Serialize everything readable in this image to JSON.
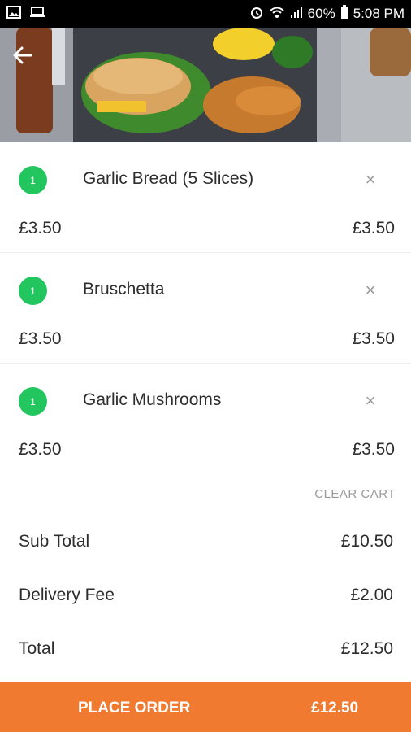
{
  "status_bar": {
    "battery": "60%",
    "time": "5:08 PM"
  },
  "header": {
    "back_icon": "arrow-left-icon"
  },
  "cart": {
    "items": [
      {
        "qty": "1",
        "name": "Garlic Bread (5 Slices)",
        "unit_price": "£3.50",
        "line_total": "£3.50"
      },
      {
        "qty": "1",
        "name": "Bruschetta",
        "unit_price": "£3.50",
        "line_total": "£3.50"
      },
      {
        "qty": "1",
        "name": "Garlic Mushrooms",
        "unit_price": "£3.50",
        "line_total": "£3.50"
      }
    ],
    "remove_symbol": "×",
    "clear_label": "CLEAR CART"
  },
  "summary": {
    "subtotal_label": "Sub Total",
    "subtotal_value": "£10.50",
    "delivery_label": "Delivery Fee",
    "delivery_value": "£2.00",
    "total_label": "Total",
    "total_value": "£12.50"
  },
  "footer": {
    "place_order_label": "PLACE ORDER",
    "place_order_amount": "£12.50"
  },
  "colors": {
    "accent": "#f07a30",
    "badge": "#22c55e",
    "status_bar": "#000000"
  }
}
